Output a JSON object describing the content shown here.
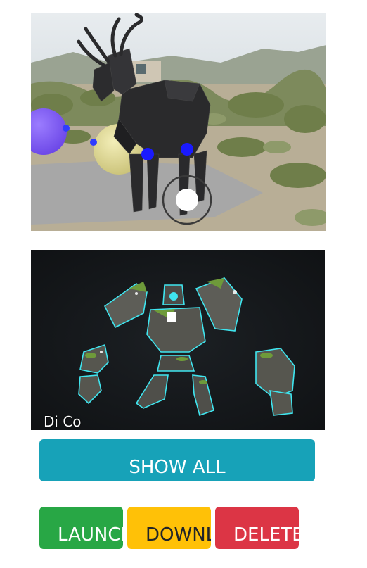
{
  "previews": [
    {
      "kind": "3d-scene-photo-background",
      "subject": "low-poly black antelope with spheres"
    },
    {
      "kind": "3d-model-thumbnail",
      "subject": "stone golem with glowing cyan runes",
      "caption": "Di Co"
    }
  ],
  "buttons": {
    "show_all": "SHOW ALL",
    "launch": "LAUNCH",
    "download": "DOWNLOAD",
    "delete": "DELETE"
  },
  "colors": {
    "show_all": "#17a2b8",
    "launch": "#28a745",
    "download": "#ffc107",
    "delete": "#dc3545"
  }
}
